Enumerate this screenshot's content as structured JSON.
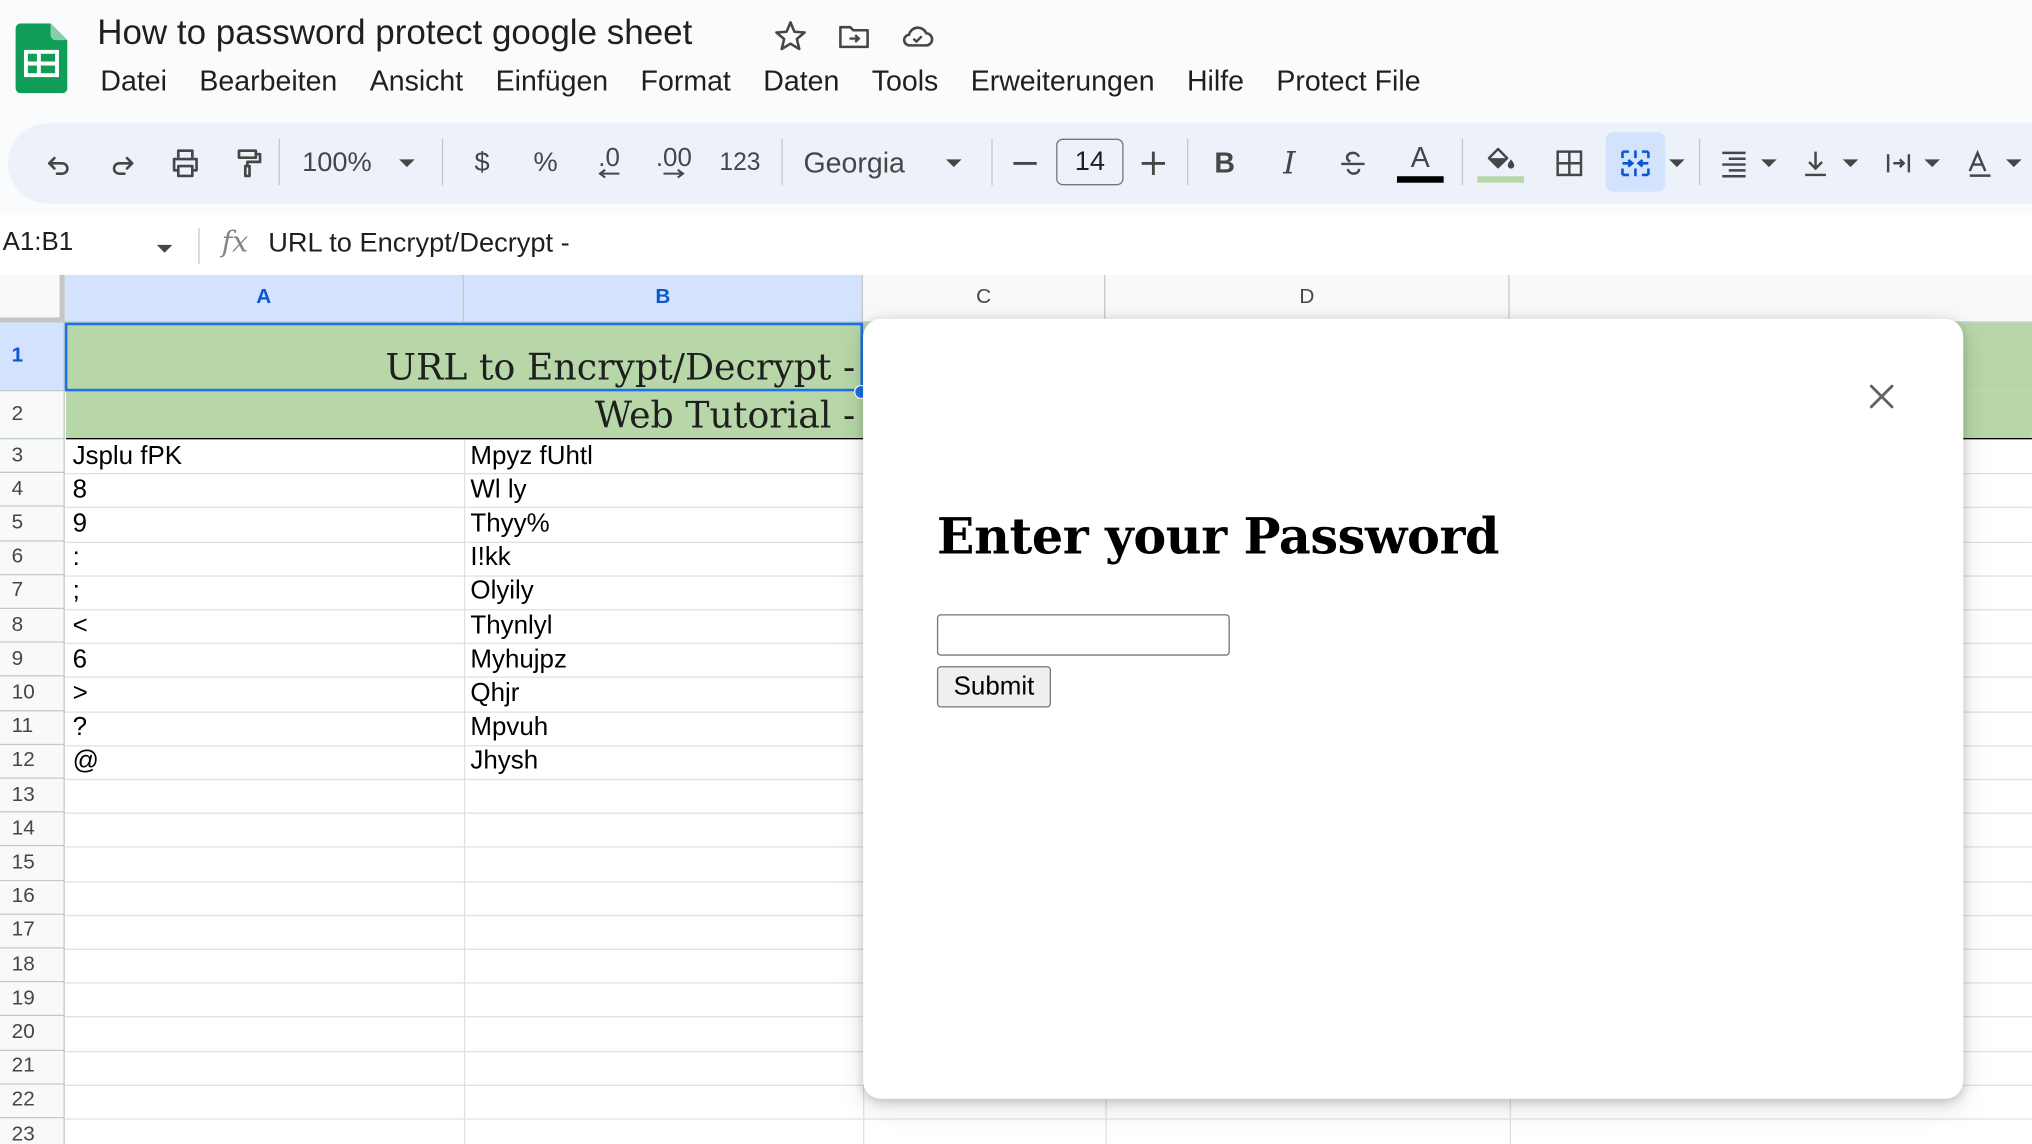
{
  "app": {
    "document_title": "How to password protect google sheet",
    "menu": [
      "Datei",
      "Bearbeiten",
      "Ansicht",
      "Einfügen",
      "Format",
      "Daten",
      "Tools",
      "Erweiterungen",
      "Hilfe",
      "Protect File"
    ]
  },
  "toolbar": {
    "zoom": "100%",
    "currency_label": "$",
    "percent_label": "%",
    "decrease_decimal_label": ".0",
    "increase_decimal_label": ".00",
    "number_format_label": "123",
    "font": "Georgia",
    "font_size": "14",
    "bold_label": "B",
    "italic_label": "I",
    "text_color_label": "A",
    "text_color": "#000000",
    "fill_color": "#b7d7a8"
  },
  "formula_bar": {
    "name_box": "A1:B1",
    "fx_label": "fx",
    "formula": "URL to Encrypt/Decrypt -"
  },
  "grid": {
    "columns": [
      "A",
      "B",
      "C",
      "D"
    ],
    "selected_columns": [
      "A",
      "B"
    ],
    "rows": [
      "1",
      "2",
      "3",
      "4",
      "5",
      "6",
      "7",
      "8",
      "9",
      "10",
      "11",
      "12",
      "13",
      "14",
      "15",
      "16",
      "17",
      "18",
      "19",
      "20",
      "21",
      "22",
      "23"
    ],
    "selected_rows": [
      "1"
    ],
    "banner_row1": "URL to Encrypt/Decrypt -",
    "banner_row2": "Web Tutorial -",
    "banner_color": "#b7d7a8",
    "data": [
      {
        "a": "Jsplu fPK",
        "b": "Mpyz fUhtl"
      },
      {
        "a": "8",
        "b": "Wl ly"
      },
      {
        "a": "9",
        "b": "Thyy%"
      },
      {
        "a": ":",
        "b": "I!kk"
      },
      {
        "a": ";",
        "b": "Olyily"
      },
      {
        "a": "<",
        "b": "Thynlyl"
      },
      {
        "a": "6",
        "b": "Myhujpz"
      },
      {
        "a": ">",
        "b": "Qhjr"
      },
      {
        "a": "?",
        "b": "Mpvuh"
      },
      {
        "a": "@",
        "b": "Jhysh"
      }
    ]
  },
  "dialog": {
    "heading": "Enter your Password",
    "password_value": "",
    "submit_label": "Submit"
  }
}
